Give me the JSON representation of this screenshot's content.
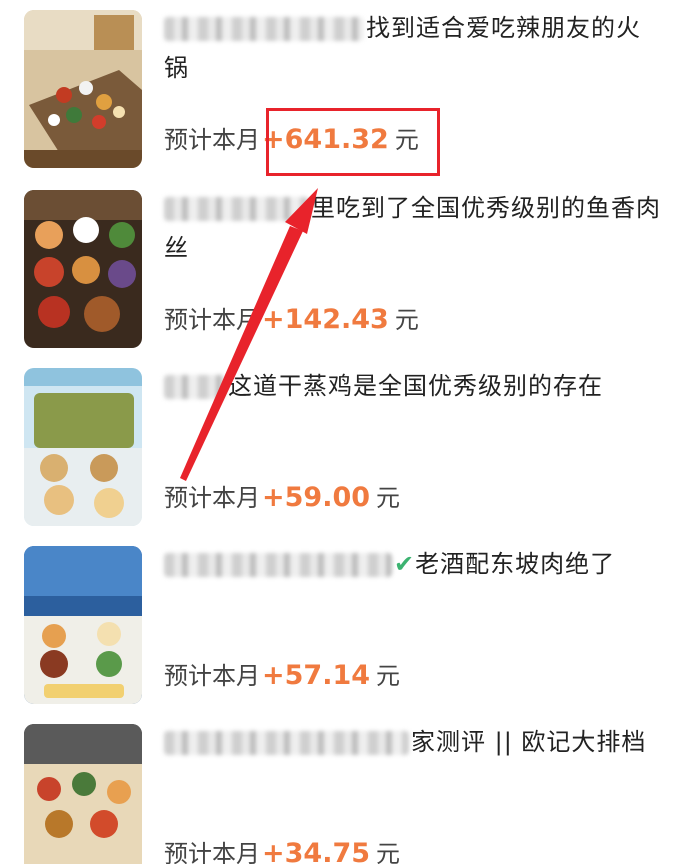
{
  "items": [
    {
      "title": "找到适合爱吃辣朋友的火锅",
      "label": "预计本月",
      "amount": "+641.32",
      "unit": "元",
      "image": "hotpot-table-photo",
      "check": ""
    },
    {
      "title": "里吃到了全国优秀级别的鱼香肉丝",
      "label": "预计本月",
      "amount": "+142.43",
      "unit": "元",
      "image": "dishes-spread-photo",
      "check": ""
    },
    {
      "title": "这道干蒸鸡是全国优秀级别的存在",
      "label": "预计本月",
      "amount": "+59.00",
      "unit": "元",
      "image": "restaurant-table-photo",
      "check": ""
    },
    {
      "title": "老酒配东坡肉绝了",
      "label": "预计本月",
      "amount": "+57.14",
      "unit": "元",
      "image": "dongpo-pork-photo",
      "check": "✔"
    },
    {
      "title": "家测评 || 欧记大排档",
      "label": "预计本月",
      "amount": "+34.75",
      "unit": "元",
      "image": "dai-pai-dong-photo",
      "check": ""
    }
  ],
  "annotation": {
    "color": "#e8232b",
    "icon": "red-arrow"
  },
  "colors": {
    "amount": "#f07a3f",
    "text": "#222222"
  }
}
